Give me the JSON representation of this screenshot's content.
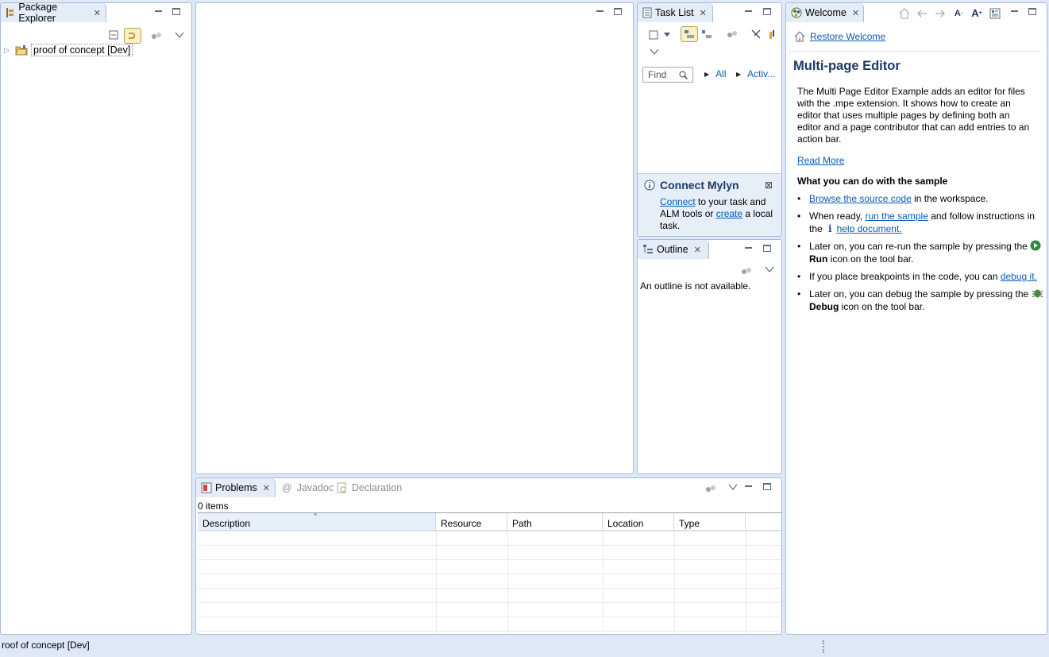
{
  "package_explorer": {
    "tab_label": "Package Explorer",
    "tree": [
      {
        "label": "proof of concept [Dev]",
        "icon": "project-folder-icon",
        "expanded": false
      }
    ]
  },
  "task_list": {
    "tab_label": "Task List",
    "find_placeholder": "Find",
    "filter_all": "All",
    "filter_active": "Activ...",
    "connect_title": "Connect Mylyn",
    "connect_link": "Connect",
    "connect_text1": " to your task and ALM tools or ",
    "create_link": "create",
    "connect_text2": " a local task."
  },
  "outline": {
    "tab_label": "Outline",
    "message": "An outline is not available."
  },
  "welcome": {
    "tab_label": "Welcome",
    "restore_link": "Restore Welcome",
    "title": "Multi-page Editor",
    "description": "The Multi Page Editor Example adds an editor for files with the .mpe extension. It shows how to create an editor that uses multiple pages by defining both an editor and a page contributor that can add entries to an action bar.",
    "read_more": "Read More",
    "section_heading": "What you can do with the sample",
    "items": {
      "browse_link": "Browse the source code",
      "browse_rest": " in the workspace.",
      "run_pre": "When ready, ",
      "run_link": "run the sample",
      "run_mid": " and follow instructions in the ",
      "help_link": "help document.",
      "rerun_pre": "Later on, you can re-run the sample by pressing the ",
      "run_bold": "Run",
      "rerun_post": " icon on the tool bar.",
      "bp_pre": "If you place breakpoints in the code, you can ",
      "bp_link": "debug it.",
      "debug_pre": "Later on, you can debug the sample by pressing the ",
      "debug_bold": "Debug",
      "debug_post": " icon on the tool bar."
    }
  },
  "problems": {
    "tabs": [
      {
        "label": "Problems",
        "active": true
      },
      {
        "label": "Javadoc",
        "active": false
      },
      {
        "label": "Declaration",
        "active": false
      }
    ],
    "count": "0 items",
    "columns": [
      "Description",
      "Resource",
      "Path",
      "Location",
      "Type"
    ]
  },
  "status_bar": {
    "text": "roof of concept [Dev]"
  }
}
